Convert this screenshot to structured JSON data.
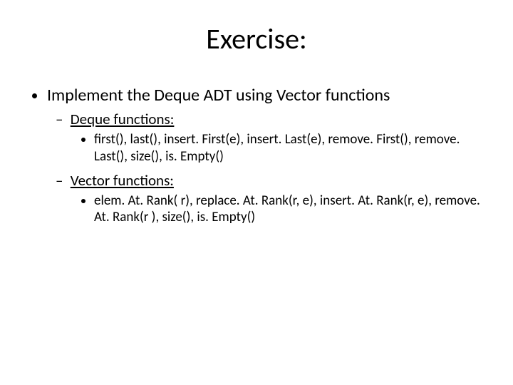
{
  "title": "Exercise:",
  "main_bullet": "Implement the Deque ADT using Vector functions",
  "sections": {
    "deque": {
      "label": "Deque functions:",
      "detail": "first(), last(), insert. First(e), insert. Last(e), remove. First(), remove. Last(), size(), is. Empty()"
    },
    "vector": {
      "label": "Vector functions:",
      "detail": "elem. At. Rank( r), replace. At. Rank(r, e), insert. At. Rank(r, e), remove. At. Rank(r ), size(), is. Empty()"
    }
  }
}
